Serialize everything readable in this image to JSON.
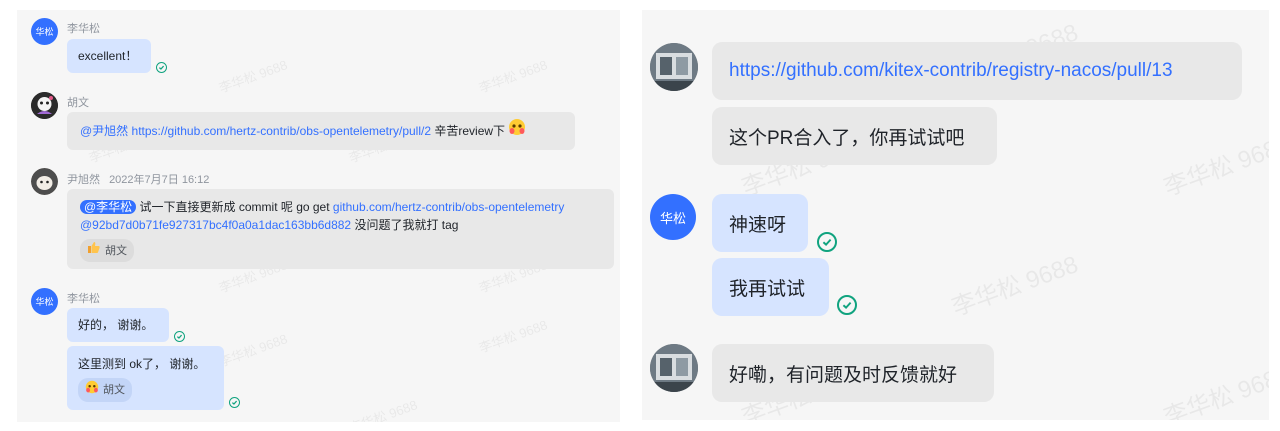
{
  "watermark": "李华松 9688",
  "left": {
    "messages": [
      {
        "sender": "李华松",
        "avatar_text": "华松",
        "text": "excellent！"
      },
      {
        "sender": "胡文",
        "mention": "@尹旭然",
        "link": "https://github.com/hertz-contrib/obs-opentelemetry/pull/2",
        "suffix": "辛苦review下"
      },
      {
        "sender": "尹旭然",
        "time": "2022年7月7日 16:12",
        "mention": "@李华松",
        "pre": "试一下直接更新成 commit 呢 go get",
        "link1": "github.com/hertz-contrib/obs-opentelemetry",
        "link2": "@92bd7d0b71fe927317bc4f0a0a1dac163bb6d882",
        "post": "没问题了我就打 tag",
        "reaction_user": "胡文"
      },
      {
        "sender": "李华松",
        "avatar_text": "华松",
        "text1": "好的， 谢谢。",
        "text2": "这里测到 ok了， 谢谢。",
        "reaction_user": "胡文"
      }
    ]
  },
  "right": {
    "link": "https://github.com/kitex-contrib/registry-nacos/pull/13",
    "msg1": "这个PR合入了，你再试试吧",
    "avatar_text": "华松",
    "msg2": "神速呀",
    "msg3": "我再试试",
    "msg4": "好嘞，有问题及时反馈就好"
  },
  "colors": {
    "accent": "#3370ff",
    "read_check": "#10a37f",
    "mine_bubble": "#d6e4ff",
    "other_bubble": "#e8e8e8"
  }
}
